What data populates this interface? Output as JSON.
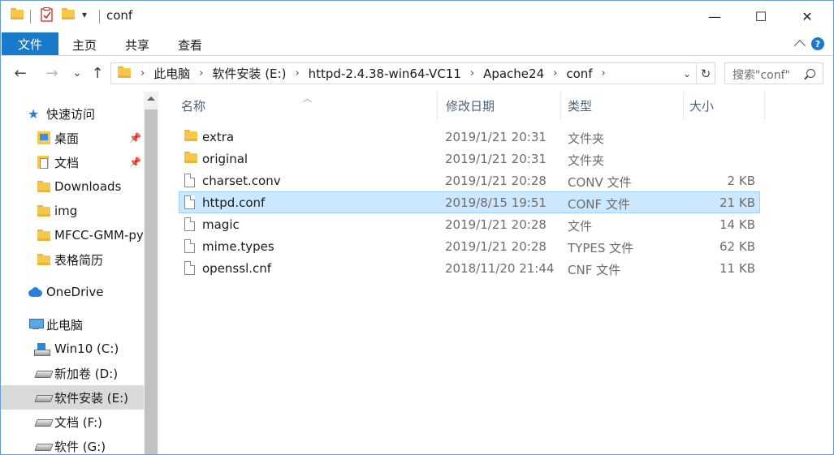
{
  "window": {
    "title": "conf",
    "minimize_glyph": "—",
    "maximize_glyph": "☐",
    "close_glyph": "✕"
  },
  "ribbon": {
    "tabs": [
      "文件",
      "主页",
      "共享",
      "查看"
    ],
    "help_glyph": "?"
  },
  "navigation": {
    "back_glyph": "←",
    "forward_glyph": "→",
    "recent_glyph": "⌄",
    "up_glyph": "↑",
    "breadcrumb": [
      "此电脑",
      "软件安装 (E:)",
      "httpd-2.4.38-win64-VC11",
      "Apache24",
      "conf"
    ],
    "crumb_separator": "›",
    "refresh_glyph": "↻",
    "dropdown_glyph": "⌄",
    "search_placeholder": "搜索\"conf\""
  },
  "sidebar": {
    "quick_access": "快速访问",
    "items": [
      {
        "label": "桌面",
        "icon": "desktop-icon",
        "pinned": true
      },
      {
        "label": "文档",
        "icon": "document-folder-icon",
        "pinned": true
      },
      {
        "label": "Downloads",
        "icon": "folder-icon",
        "pinned": false
      },
      {
        "label": "img",
        "icon": "folder-icon",
        "pinned": false
      },
      {
        "label": "MFCC-GMM-py",
        "icon": "folder-icon",
        "pinned": false
      },
      {
        "label": "表格简历",
        "icon": "folder-icon",
        "pinned": false
      }
    ],
    "onedrive": "OneDrive",
    "this_pc": "此电脑",
    "drives": [
      {
        "label": "Win10 (C:)",
        "icon": "windows-drive-icon",
        "selected": false
      },
      {
        "label": "新加卷 (D:)",
        "icon": "drive-icon",
        "selected": false
      },
      {
        "label": "软件安装 (E:)",
        "icon": "drive-icon",
        "selected": true
      },
      {
        "label": "文档 (F:)",
        "icon": "drive-icon",
        "selected": false
      },
      {
        "label": "软件 (G:)",
        "icon": "drive-icon",
        "selected": false
      }
    ],
    "pin_glyph": "📌"
  },
  "columns": {
    "name": "名称",
    "date": "修改日期",
    "type": "类型",
    "size": "大小",
    "sort_glyph": "︿"
  },
  "files": [
    {
      "name": "extra",
      "date": "2019/1/21 20:31",
      "type": "文件夹",
      "size": "",
      "kind": "folder",
      "selected": false
    },
    {
      "name": "original",
      "date": "2019/1/21 20:31",
      "type": "文件夹",
      "size": "",
      "kind": "folder",
      "selected": false
    },
    {
      "name": "charset.conv",
      "date": "2019/1/21 20:28",
      "type": "CONV 文件",
      "size": "2 KB",
      "kind": "file",
      "selected": false
    },
    {
      "name": "httpd.conf",
      "date": "2019/8/15 19:51",
      "type": "CONF 文件",
      "size": "21 KB",
      "kind": "file",
      "selected": true
    },
    {
      "name": "magic",
      "date": "2019/1/21 20:28",
      "type": "文件",
      "size": "14 KB",
      "kind": "file",
      "selected": false
    },
    {
      "name": "mime.types",
      "date": "2019/1/21 20:28",
      "type": "TYPES 文件",
      "size": "62 KB",
      "kind": "file",
      "selected": false
    },
    {
      "name": "openssl.cnf",
      "date": "2018/11/20 21:44",
      "type": "CNF 文件",
      "size": "11 KB",
      "kind": "file",
      "selected": false
    }
  ],
  "colors": {
    "accent": "#1979ca",
    "selection": "#cce8ff",
    "selection_border": "#99d1ff",
    "sidebar_selected": "#d9d9d9"
  }
}
